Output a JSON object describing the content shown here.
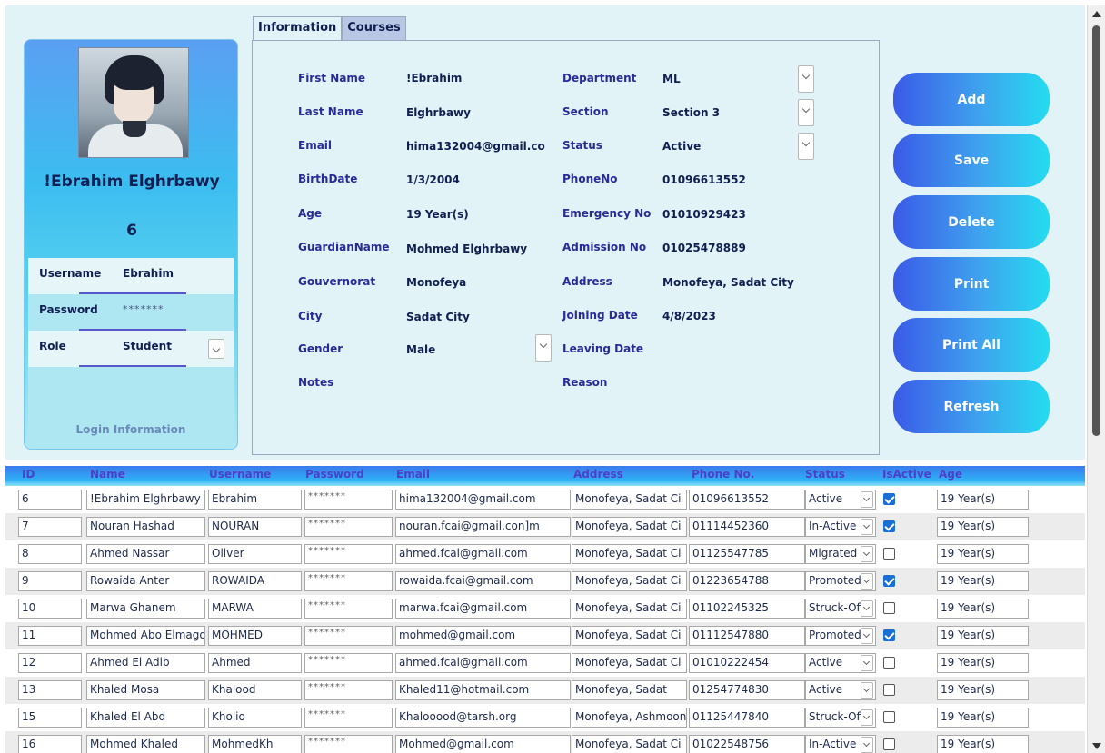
{
  "profile": {
    "name": "!Ebrahim Elghrbawy",
    "id": "6",
    "login": {
      "username_label": "Username",
      "username_value": "Ebrahim",
      "password_label": "Password",
      "password_value": "*******",
      "role_label": "Role",
      "role_value": "Student",
      "caption": "Login Information"
    }
  },
  "tabs": [
    "Information",
    "Courses"
  ],
  "info": {
    "first_name_label": "First Name",
    "first_name": "!Ebrahim",
    "last_name_label": "Last Name",
    "last_name": "Elghrbawy",
    "email_label": "Email",
    "email": "hima132004@gmail.co",
    "birthdate_label": "BirthDate",
    "birthdate": "1/3/2004",
    "age_label": "Age",
    "age": "19 Year(s)",
    "guardian_label": "GuardianName",
    "guardian": "Mohmed Elghrbawy",
    "gouvernorat_label": "Gouvernorat",
    "gouvernorat": "Monofeya",
    "city_label": "City",
    "city": "Sadat City",
    "gender_label": "Gender",
    "gender": "Male",
    "notes_label": "Notes",
    "department_label": "Department",
    "department": "ML",
    "section_label": "Section",
    "section": "Section 3",
    "status_label": "Status",
    "status": "Active",
    "phone_label": "PhoneNo",
    "phone": "01096613552",
    "emergency_label": "Emergency No",
    "emergency": "01010929423",
    "admission_label": "Admission No",
    "admission": "01025478889",
    "address_label": "Address",
    "address": "Monofeya, Sadat City",
    "joining_label": "Joining Date",
    "joining": "4/8/2023",
    "leaving_label": "Leaving Date",
    "reason_label": "Reason"
  },
  "actions": {
    "add": "Add",
    "save": "Save",
    "delete": "Delete",
    "print": "Print",
    "print_all": "Print All",
    "refresh": "Refresh"
  },
  "grid": {
    "columns": [
      "ID",
      "Name",
      "Username",
      "Password",
      "Email",
      "Address",
      "Phone No.",
      "Status",
      "IsActive",
      "Age"
    ],
    "rows": [
      {
        "id": "6",
        "name": "!Ebrahim Elghrbawy",
        "username": "Ebrahim",
        "password": "*******",
        "email": "hima132004@gmail.com",
        "address": "Monofeya, Sadat Ci",
        "phone": "01096613552",
        "status": "Active",
        "active": true,
        "age": "19 Year(s)"
      },
      {
        "id": "7",
        "name": "Nouran Hashad",
        "username": "NOURAN",
        "password": "*******",
        "email": "nouran.fcai@gmail.con]m",
        "address": "Monofeya, Sadat Ci",
        "phone": "01114452360",
        "status": "In-Active",
        "active": true,
        "age": "19 Year(s)"
      },
      {
        "id": "8",
        "name": "Ahmed Nassar",
        "username": "Oliver",
        "password": "*******",
        "email": "ahmed.fcai@gmail.com",
        "address": "Monofeya, Sadat Ci",
        "phone": "01125547785",
        "status": "Migrated",
        "active": false,
        "age": "19 Year(s)"
      },
      {
        "id": "9",
        "name": "Rowaida Anter",
        "username": "ROWAIDA",
        "password": "*******",
        "email": "rowaida.fcai@gmail.com",
        "address": "Monofeya, Sadat Ci",
        "phone": "01223654788",
        "status": "Promoted",
        "active": true,
        "age": "19 Year(s)"
      },
      {
        "id": "10",
        "name": "Marwa Ghanem",
        "username": "MARWA",
        "password": "*******",
        "email": "marwa.fcai@gmail.com",
        "address": "Monofeya, Sadat Ci",
        "phone": "01102245325",
        "status": "Struck-Off",
        "active": false,
        "age": "19 Year(s)"
      },
      {
        "id": "11",
        "name": "Mohmed Abo Elmagd",
        "username": "MOHMED",
        "password": "*******",
        "email": "mohmed@gmail.com",
        "address": "Monofeya, Sadat Ci",
        "phone": "01112547880",
        "status": "Promoted",
        "active": true,
        "age": "19 Year(s)"
      },
      {
        "id": "12",
        "name": "Ahmed El Adib",
        "username": "Ahmed",
        "password": "*******",
        "email": "ahmed.fcai@gmail.com",
        "address": "Monofeya, Sadat Ci",
        "phone": "01010222454",
        "status": "Active",
        "active": false,
        "age": "19 Year(s)"
      },
      {
        "id": "13",
        "name": "Khaled Mosa",
        "username": "Khalood",
        "password": "*******",
        "email": "Khaled11@hotmail.com",
        "address": "Monofeya, Sadat",
        "phone": "01254774830",
        "status": "Active",
        "active": false,
        "age": "19 Year(s)"
      },
      {
        "id": "15",
        "name": "Khaled El Abd",
        "username": "Kholio",
        "password": "*******",
        "email": "Khalooood@tarsh.org",
        "address": "Monofeya, Ashmoon",
        "phone": "01125447840",
        "status": "Struck-Off",
        "active": false,
        "age": "19 Year(s)"
      },
      {
        "id": "16",
        "name": "Mohmed Khaled",
        "username": "MohmedKh",
        "password": "*******",
        "email": "Mohmed@gmail.com",
        "address": "Monofeya, Sadat Ci",
        "phone": "01022548756",
        "status": "In-Active",
        "active": false,
        "age": "19 Year(s)"
      }
    ]
  }
}
